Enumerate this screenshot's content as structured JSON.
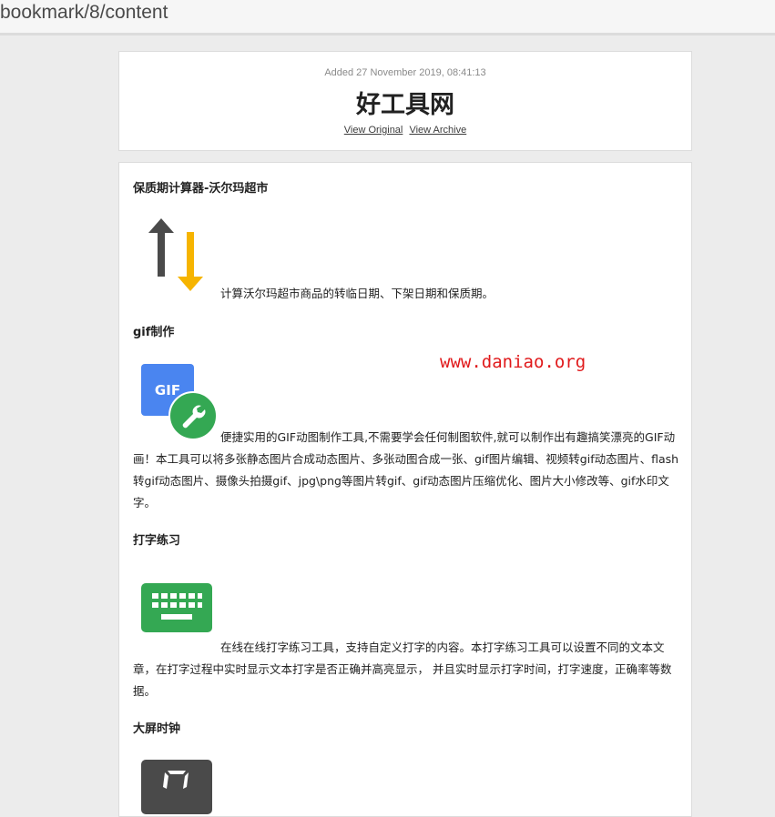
{
  "address_bar": {
    "url": "bookmark/8/content"
  },
  "header": {
    "added": "Added 27 November 2019, 08:41:13",
    "title": "好工具网",
    "view_original": "View Original",
    "view_archive": "View Archive"
  },
  "sections": [
    {
      "title": "保质期计算器-沃尔玛超市",
      "icon": "arrows-up-down-icon",
      "description": "计算沃尔玛超市商品的转临日期、下架日期和保质期。"
    },
    {
      "title": "gif制作",
      "icon": "gif-wrench-icon",
      "description": "便捷实用的GIF动图制作工具,不需要学会任何制图软件,就可以制作出有趣搞笑漂亮的GIF动画！本工具可以将多张静态图片合成动态图片、多张动图合成一张、gif图片编辑、视频转gif动态图片、flash转gif动态图片、摄像头拍摄gif、jpg\\png等图片转gif、gif动态图片压缩优化、图片大小修改等、gif水印文字。"
    },
    {
      "title": "打字练习",
      "icon": "keyboard-icon",
      "description": "在线在线打字练习工具，支持自定义打字的内容。本打字练习工具可以设置不同的文本文章，在打字过程中实时显示文本打字是否正确并高亮显示， 并且实时显示打字时间，打字速度，正确率等数据。"
    },
    {
      "title": "大屏时钟",
      "icon": "digital-clock-icon",
      "description": ""
    }
  ],
  "watermark": "www.daniao.org",
  "colors": {
    "link": "#3b3b3b",
    "arrow_dark": "#4a4a4a",
    "arrow_yellow": "#f6b400",
    "gif_blue": "#4a85f0",
    "green": "#34a853",
    "watermark": "#e0191b"
  }
}
